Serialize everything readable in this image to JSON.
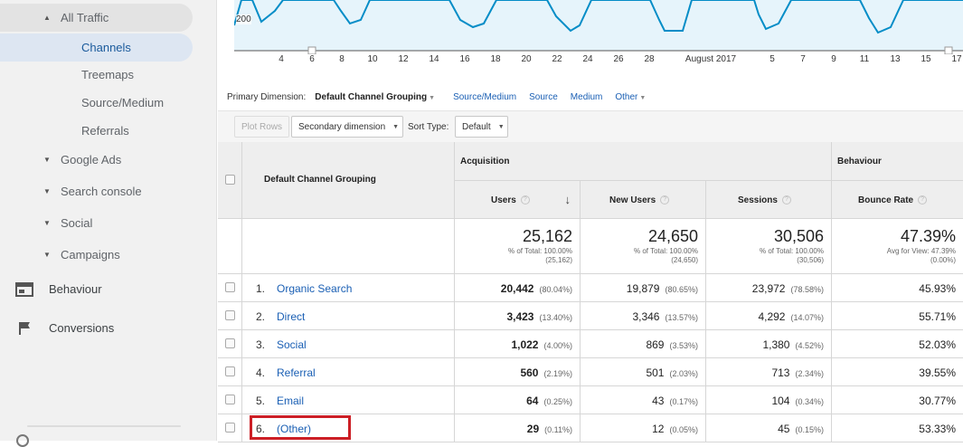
{
  "sidebar": {
    "all_traffic": "All Traffic",
    "sub_items": [
      "Channels",
      "Treemaps",
      "Source/Medium",
      "Referrals"
    ],
    "groups": [
      "Google Ads",
      "Search console",
      "Social",
      "Campaigns"
    ],
    "top_items": [
      "Behaviour",
      "Conversions"
    ]
  },
  "chart_data": {
    "type": "line",
    "y_tick_label": "200",
    "x_labels": [
      "4",
      "6",
      "8",
      "10",
      "12",
      "14",
      "16",
      "18",
      "20",
      "22",
      "24",
      "26",
      "28",
      "August 2017",
      "5",
      "7",
      "9",
      "11",
      "13",
      "15",
      "17"
    ],
    "line_color": "#058dc7",
    "fill_color": "#e6f4fb"
  },
  "dimension_bar": {
    "label": "Primary Dimension:",
    "selected": "Default Channel Grouping",
    "links": [
      "Source/Medium",
      "Source",
      "Medium",
      "Other"
    ]
  },
  "toolbar": {
    "plot_rows": "Plot Rows",
    "secondary_dimension": "Secondary dimension",
    "sort_type_label": "Sort Type:",
    "sort_type_value": "Default"
  },
  "table": {
    "dimension_header": "Default Channel Grouping",
    "group_acquisition": "Acquisition",
    "group_behaviour": "Behaviour",
    "columns": [
      "Users",
      "New Users",
      "Sessions",
      "Bounce Rate"
    ],
    "help_glyph": "?",
    "sort_arrow": "↓",
    "totals": [
      {
        "value": "25,162",
        "line1": "% of Total: 100.00%",
        "line2": "(25,162)"
      },
      {
        "value": "24,650",
        "line1": "% of Total: 100.00%",
        "line2": "(24,650)"
      },
      {
        "value": "30,506",
        "line1": "% of Total: 100.00%",
        "line2": "(30,506)"
      },
      {
        "value": "47.39%",
        "line1": "Avg for View: 47.39%",
        "line2": "(0.00%)"
      }
    ],
    "rows": [
      {
        "num": "1.",
        "name": "Organic Search",
        "users": "20,442",
        "users_pct": "(80.04%)",
        "new_users": "19,879",
        "new_users_pct": "(80.65%)",
        "sessions": "23,972",
        "sessions_pct": "(78.58%)",
        "bounce": "45.93%"
      },
      {
        "num": "2.",
        "name": "Direct",
        "users": "3,423",
        "users_pct": "(13.40%)",
        "new_users": "3,346",
        "new_users_pct": "(13.57%)",
        "sessions": "4,292",
        "sessions_pct": "(14.07%)",
        "bounce": "55.71%"
      },
      {
        "num": "3.",
        "name": "Social",
        "users": "1,022",
        "users_pct": "(4.00%)",
        "new_users": "869",
        "new_users_pct": "(3.53%)",
        "sessions": "1,380",
        "sessions_pct": "(4.52%)",
        "bounce": "52.03%"
      },
      {
        "num": "4.",
        "name": "Referral",
        "users": "560",
        "users_pct": "(2.19%)",
        "new_users": "501",
        "new_users_pct": "(2.03%)",
        "sessions": "713",
        "sessions_pct": "(2.34%)",
        "bounce": "39.55%"
      },
      {
        "num": "5.",
        "name": "Email",
        "users": "64",
        "users_pct": "(0.25%)",
        "new_users": "43",
        "new_users_pct": "(0.17%)",
        "sessions": "104",
        "sessions_pct": "(0.34%)",
        "bounce": "30.77%"
      },
      {
        "num": "6.",
        "name": "(Other)",
        "users": "29",
        "users_pct": "(0.11%)",
        "new_users": "12",
        "new_users_pct": "(0.05%)",
        "sessions": "45",
        "sessions_pct": "(0.15%)",
        "bounce": "53.33%"
      }
    ],
    "highlight_color": "#cc1f26"
  }
}
